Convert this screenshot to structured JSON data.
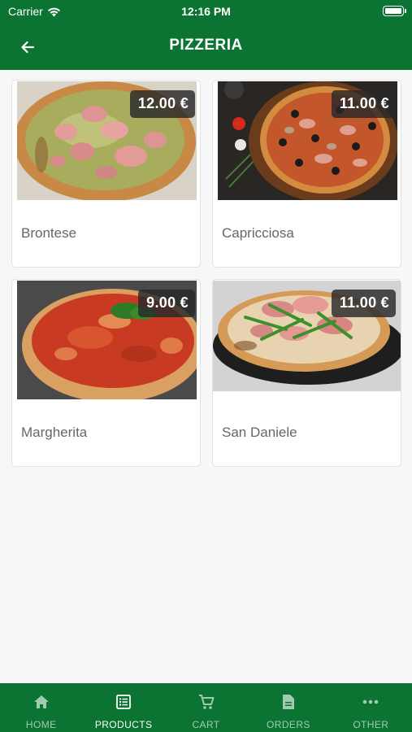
{
  "status_bar": {
    "carrier": "Carrier",
    "time": "12:16 PM"
  },
  "nav": {
    "title": "PIZZERIA",
    "back_icon": "arrow-left-icon"
  },
  "products": [
    {
      "name": "Brontese",
      "price": "12.00 €"
    },
    {
      "name": "Capricciosa",
      "price": "11.00 €"
    },
    {
      "name": "Margherita",
      "price": "9.00 €"
    },
    {
      "name": "San Daniele",
      "price": "11.00 €"
    }
  ],
  "tabs": [
    {
      "label": "HOME",
      "icon": "home-icon",
      "active": false
    },
    {
      "label": "PRODUCTS",
      "icon": "list-icon",
      "active": true
    },
    {
      "label": "CART",
      "icon": "cart-icon",
      "active": false
    },
    {
      "label": "ORDERS",
      "icon": "document-icon",
      "active": false
    },
    {
      "label": "OTHER",
      "icon": "more-icon",
      "active": false
    }
  ],
  "colors": {
    "primary": "#0b7432",
    "background": "#f7f7f7",
    "card": "#ffffff",
    "price_badge": "#282828",
    "product_name": "#666666"
  }
}
